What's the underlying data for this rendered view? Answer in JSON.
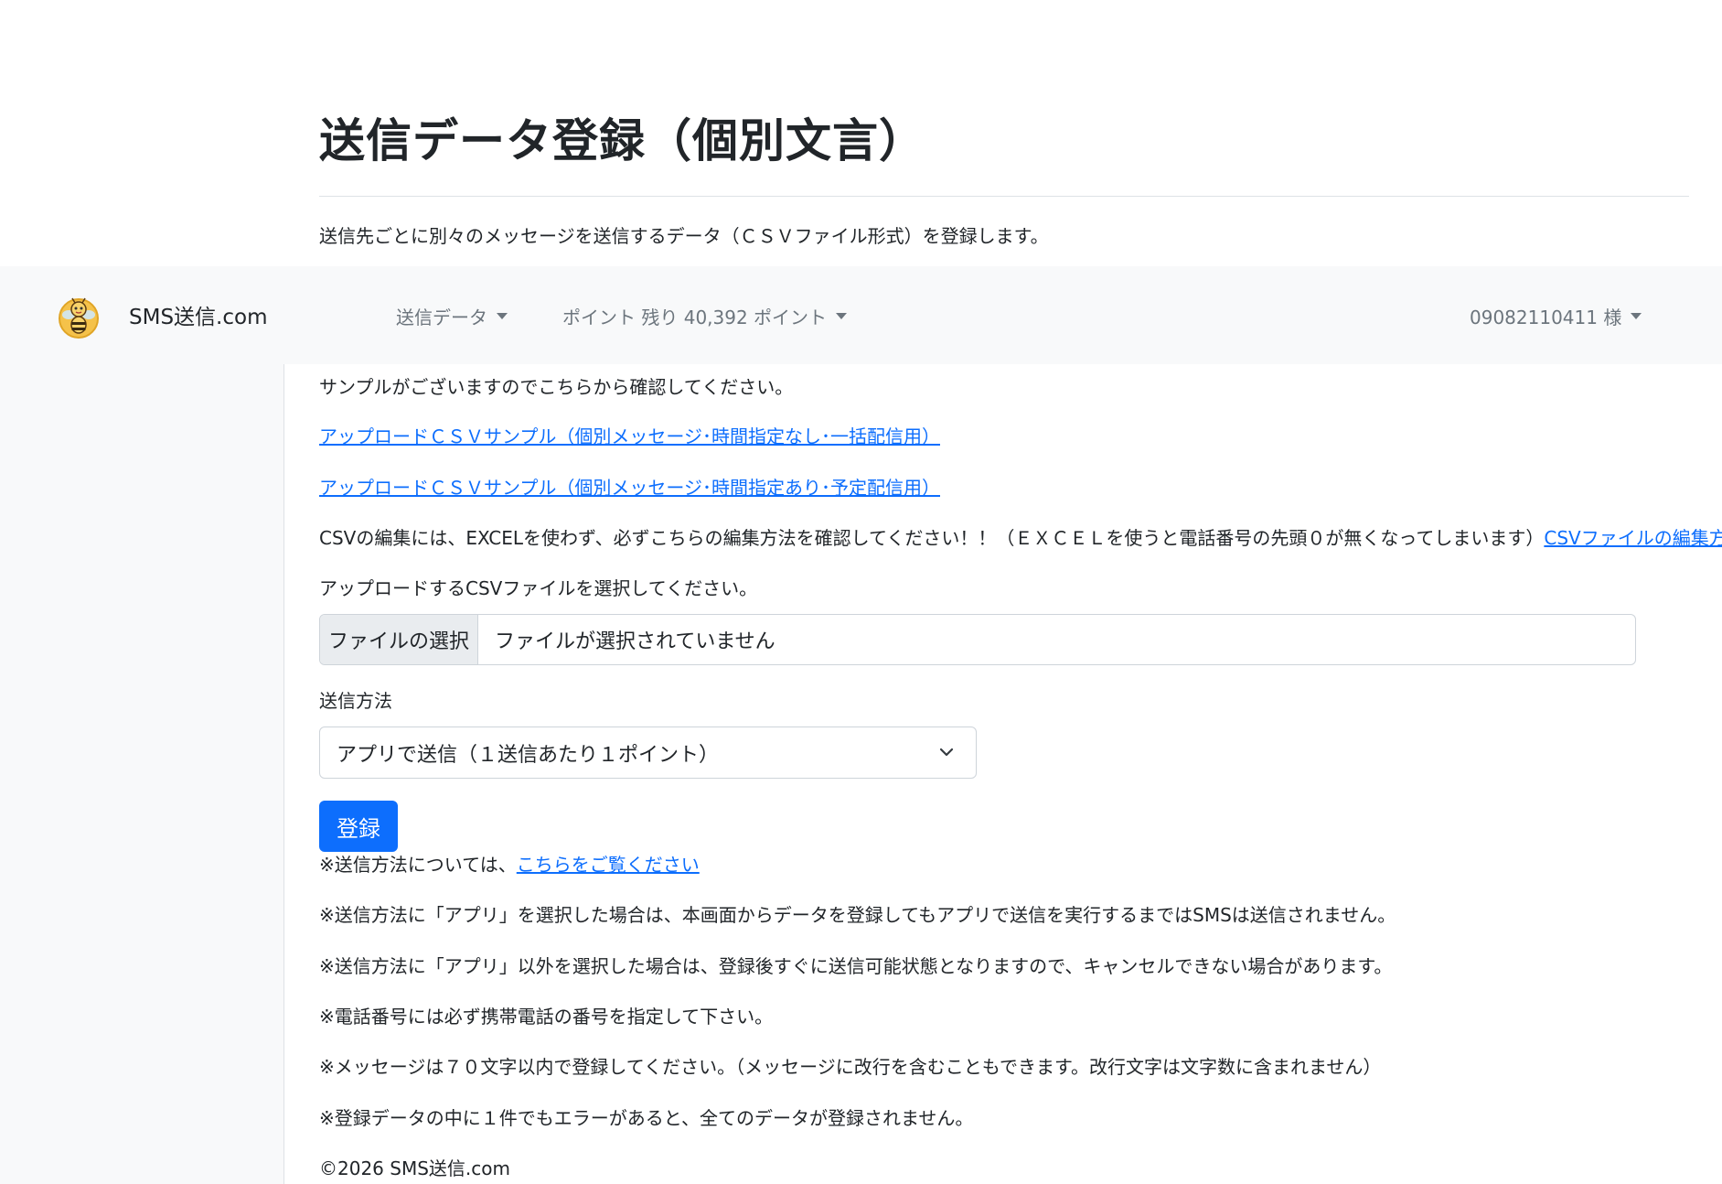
{
  "header": {
    "title": "送信データ登録（個別文言）",
    "description": "送信先ごとに別々のメッセージを送信するデータ（ＣＳＶファイル形式）を登録します。"
  },
  "navbar": {
    "brand": "SMS送信.com",
    "menu_send_data": "送信データ",
    "menu_points": "ポイント 残り 40,392 ポイント",
    "menu_user": "09082110411 様"
  },
  "content": {
    "sample_intro": "サンプルがございますのでこちらから確認してください。",
    "sample_link_1": "アップロードＣＳＶサンプル（個別メッセージ･時間指定なし･一括配信用）",
    "sample_link_2": "アップロードＣＳＶサンプル（個別メッセージ･時間指定あり･予定配信用）",
    "csv_note": "CSVの編集には、EXCELを使わず、必ずこちらの編集方法を確認してください！！（ＥＸＣＥＬを使うと電話番号の先頭０が無くなってしまいます）",
    "csv_edit_link": "CSVファイルの編集方法",
    "file_label": "アップロードするCSVファイルを選択してください。",
    "file_button": "ファイルの選択",
    "file_status": "ファイルが選択されていません",
    "method_label": "送信方法",
    "method_selected": "アプリで送信（１送信あたり１ポイント）",
    "submit_label": "登録",
    "note_method_prefix": "※送信方法については、",
    "note_method_link": "こちらをご覧ください",
    "note_app": "※送信方法に「アプリ」を選択した場合は、本画面からデータを登録してもアプリで送信を実行するまではSMSは送信されません。",
    "note_non_app": "※送信方法に「アプリ」以外を選択した場合は、登録後すぐに送信可能状態となりますので、キャンセルできない場合があります。",
    "note_phone": "※電話番号には必ず携帯電話の番号を指定して下さい。",
    "note_message": "※メッセージは７０文字以内で登録してください。（メッセージに改行を含むこともできます。改行文字は文字数に含まれません）",
    "note_error": "※登録データの中に１件でもエラーがあると、全てのデータが登録されません。",
    "copyright": "©2026 SMS送信.com"
  },
  "colors": {
    "primary": "#0d6efd",
    "navbar_bg": "#f8f9fa",
    "nav_text": "#6c757d"
  },
  "icons": {
    "logo": "bee-mascot-icon",
    "dropdown": "caret-down-icon",
    "select": "chevron-down-icon"
  }
}
